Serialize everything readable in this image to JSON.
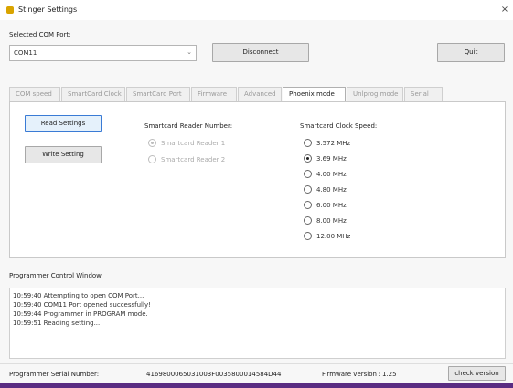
{
  "window": {
    "title": "Stinger Settings",
    "close_glyph": "×"
  },
  "com": {
    "label": "Selected COM Port:",
    "selected": "COM11",
    "disconnect_label": "Disconnect",
    "quit_label": "Quit"
  },
  "tabs": [
    {
      "label": "COM speed",
      "active": false
    },
    {
      "label": "SmartCard Clock",
      "active": false
    },
    {
      "label": "SmartCard Port",
      "active": false
    },
    {
      "label": "Firmware",
      "active": false
    },
    {
      "label": "Advanced",
      "active": false
    },
    {
      "label": "Phoenix mode",
      "active": true
    },
    {
      "label": "Unlprog mode",
      "active": false
    },
    {
      "label": "Serial",
      "active": false
    }
  ],
  "panel": {
    "read_settings_label": "Read Settings",
    "write_setting_label": "Write Setting",
    "reader_heading": "Smartcard Reader Number:",
    "readers": [
      {
        "label": "Smartcard Reader 1",
        "selected": true
      },
      {
        "label": "Smartcard Reader 2",
        "selected": false
      }
    ],
    "clock_heading": "Smartcard Clock Speed:",
    "clocks": [
      {
        "label": "3.572 MHz",
        "selected": false
      },
      {
        "label": "3.69 MHz",
        "selected": true
      },
      {
        "label": "4.00 MHz",
        "selected": false
      },
      {
        "label": "4.80 MHz",
        "selected": false
      },
      {
        "label": "6.00 MHz",
        "selected": false
      },
      {
        "label": "8.00 MHz",
        "selected": false
      },
      {
        "label": "12.00 MHz",
        "selected": false
      }
    ]
  },
  "log": {
    "heading": "Programmer Control Window",
    "lines": [
      "10:59:40 Attempting to open COM Port...",
      "10:59:40 COM11 Port opened successfully!",
      "10:59:44 Programmer in PROGRAM mode.",
      "10:59:51 Reading setting..."
    ]
  },
  "status": {
    "serial_label": "Programmer Serial Number:",
    "serial_value": "4169800065031003F0035800014584D44",
    "firmware_label": "Firmware version :",
    "firmware_value": "1.25",
    "check_version_label": "check version"
  },
  "colors": {
    "accent_bar": "#5a2c82",
    "app_icon": "#d9a400"
  }
}
